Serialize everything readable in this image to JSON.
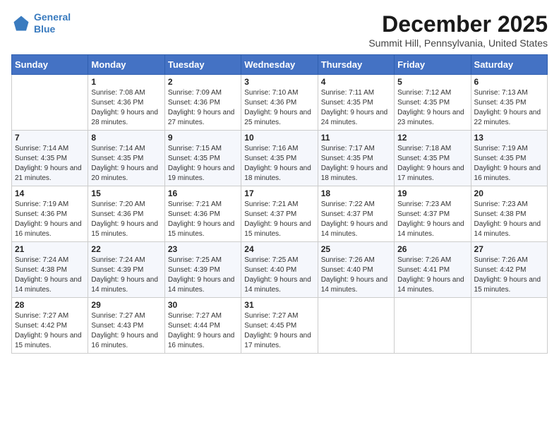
{
  "logo": {
    "line1": "General",
    "line2": "Blue"
  },
  "title": "December 2025",
  "location": "Summit Hill, Pennsylvania, United States",
  "days_of_week": [
    "Sunday",
    "Monday",
    "Tuesday",
    "Wednesday",
    "Thursday",
    "Friday",
    "Saturday"
  ],
  "weeks": [
    [
      {
        "day": "",
        "sunrise": "",
        "sunset": "",
        "daylight": ""
      },
      {
        "day": "1",
        "sunrise": "Sunrise: 7:08 AM",
        "sunset": "Sunset: 4:36 PM",
        "daylight": "Daylight: 9 hours and 28 minutes."
      },
      {
        "day": "2",
        "sunrise": "Sunrise: 7:09 AM",
        "sunset": "Sunset: 4:36 PM",
        "daylight": "Daylight: 9 hours and 27 minutes."
      },
      {
        "day": "3",
        "sunrise": "Sunrise: 7:10 AM",
        "sunset": "Sunset: 4:36 PM",
        "daylight": "Daylight: 9 hours and 25 minutes."
      },
      {
        "day": "4",
        "sunrise": "Sunrise: 7:11 AM",
        "sunset": "Sunset: 4:35 PM",
        "daylight": "Daylight: 9 hours and 24 minutes."
      },
      {
        "day": "5",
        "sunrise": "Sunrise: 7:12 AM",
        "sunset": "Sunset: 4:35 PM",
        "daylight": "Daylight: 9 hours and 23 minutes."
      },
      {
        "day": "6",
        "sunrise": "Sunrise: 7:13 AM",
        "sunset": "Sunset: 4:35 PM",
        "daylight": "Daylight: 9 hours and 22 minutes."
      }
    ],
    [
      {
        "day": "7",
        "sunrise": "Sunrise: 7:14 AM",
        "sunset": "Sunset: 4:35 PM",
        "daylight": "Daylight: 9 hours and 21 minutes."
      },
      {
        "day": "8",
        "sunrise": "Sunrise: 7:14 AM",
        "sunset": "Sunset: 4:35 PM",
        "daylight": "Daylight: 9 hours and 20 minutes."
      },
      {
        "day": "9",
        "sunrise": "Sunrise: 7:15 AM",
        "sunset": "Sunset: 4:35 PM",
        "daylight": "Daylight: 9 hours and 19 minutes."
      },
      {
        "day": "10",
        "sunrise": "Sunrise: 7:16 AM",
        "sunset": "Sunset: 4:35 PM",
        "daylight": "Daylight: 9 hours and 18 minutes."
      },
      {
        "day": "11",
        "sunrise": "Sunrise: 7:17 AM",
        "sunset": "Sunset: 4:35 PM",
        "daylight": "Daylight: 9 hours and 18 minutes."
      },
      {
        "day": "12",
        "sunrise": "Sunrise: 7:18 AM",
        "sunset": "Sunset: 4:35 PM",
        "daylight": "Daylight: 9 hours and 17 minutes."
      },
      {
        "day": "13",
        "sunrise": "Sunrise: 7:19 AM",
        "sunset": "Sunset: 4:35 PM",
        "daylight": "Daylight: 9 hours and 16 minutes."
      }
    ],
    [
      {
        "day": "14",
        "sunrise": "Sunrise: 7:19 AM",
        "sunset": "Sunset: 4:36 PM",
        "daylight": "Daylight: 9 hours and 16 minutes."
      },
      {
        "day": "15",
        "sunrise": "Sunrise: 7:20 AM",
        "sunset": "Sunset: 4:36 PM",
        "daylight": "Daylight: 9 hours and 15 minutes."
      },
      {
        "day": "16",
        "sunrise": "Sunrise: 7:21 AM",
        "sunset": "Sunset: 4:36 PM",
        "daylight": "Daylight: 9 hours and 15 minutes."
      },
      {
        "day": "17",
        "sunrise": "Sunrise: 7:21 AM",
        "sunset": "Sunset: 4:37 PM",
        "daylight": "Daylight: 9 hours and 15 minutes."
      },
      {
        "day": "18",
        "sunrise": "Sunrise: 7:22 AM",
        "sunset": "Sunset: 4:37 PM",
        "daylight": "Daylight: 9 hours and 14 minutes."
      },
      {
        "day": "19",
        "sunrise": "Sunrise: 7:23 AM",
        "sunset": "Sunset: 4:37 PM",
        "daylight": "Daylight: 9 hours and 14 minutes."
      },
      {
        "day": "20",
        "sunrise": "Sunrise: 7:23 AM",
        "sunset": "Sunset: 4:38 PM",
        "daylight": "Daylight: 9 hours and 14 minutes."
      }
    ],
    [
      {
        "day": "21",
        "sunrise": "Sunrise: 7:24 AM",
        "sunset": "Sunset: 4:38 PM",
        "daylight": "Daylight: 9 hours and 14 minutes."
      },
      {
        "day": "22",
        "sunrise": "Sunrise: 7:24 AM",
        "sunset": "Sunset: 4:39 PM",
        "daylight": "Daylight: 9 hours and 14 minutes."
      },
      {
        "day": "23",
        "sunrise": "Sunrise: 7:25 AM",
        "sunset": "Sunset: 4:39 PM",
        "daylight": "Daylight: 9 hours and 14 minutes."
      },
      {
        "day": "24",
        "sunrise": "Sunrise: 7:25 AM",
        "sunset": "Sunset: 4:40 PM",
        "daylight": "Daylight: 9 hours and 14 minutes."
      },
      {
        "day": "25",
        "sunrise": "Sunrise: 7:26 AM",
        "sunset": "Sunset: 4:40 PM",
        "daylight": "Daylight: 9 hours and 14 minutes."
      },
      {
        "day": "26",
        "sunrise": "Sunrise: 7:26 AM",
        "sunset": "Sunset: 4:41 PM",
        "daylight": "Daylight: 9 hours and 14 minutes."
      },
      {
        "day": "27",
        "sunrise": "Sunrise: 7:26 AM",
        "sunset": "Sunset: 4:42 PM",
        "daylight": "Daylight: 9 hours and 15 minutes."
      }
    ],
    [
      {
        "day": "28",
        "sunrise": "Sunrise: 7:27 AM",
        "sunset": "Sunset: 4:42 PM",
        "daylight": "Daylight: 9 hours and 15 minutes."
      },
      {
        "day": "29",
        "sunrise": "Sunrise: 7:27 AM",
        "sunset": "Sunset: 4:43 PM",
        "daylight": "Daylight: 9 hours and 16 minutes."
      },
      {
        "day": "30",
        "sunrise": "Sunrise: 7:27 AM",
        "sunset": "Sunset: 4:44 PM",
        "daylight": "Daylight: 9 hours and 16 minutes."
      },
      {
        "day": "31",
        "sunrise": "Sunrise: 7:27 AM",
        "sunset": "Sunset: 4:45 PM",
        "daylight": "Daylight: 9 hours and 17 minutes."
      },
      {
        "day": "",
        "sunrise": "",
        "sunset": "",
        "daylight": ""
      },
      {
        "day": "",
        "sunrise": "",
        "sunset": "",
        "daylight": ""
      },
      {
        "day": "",
        "sunrise": "",
        "sunset": "",
        "daylight": ""
      }
    ]
  ]
}
